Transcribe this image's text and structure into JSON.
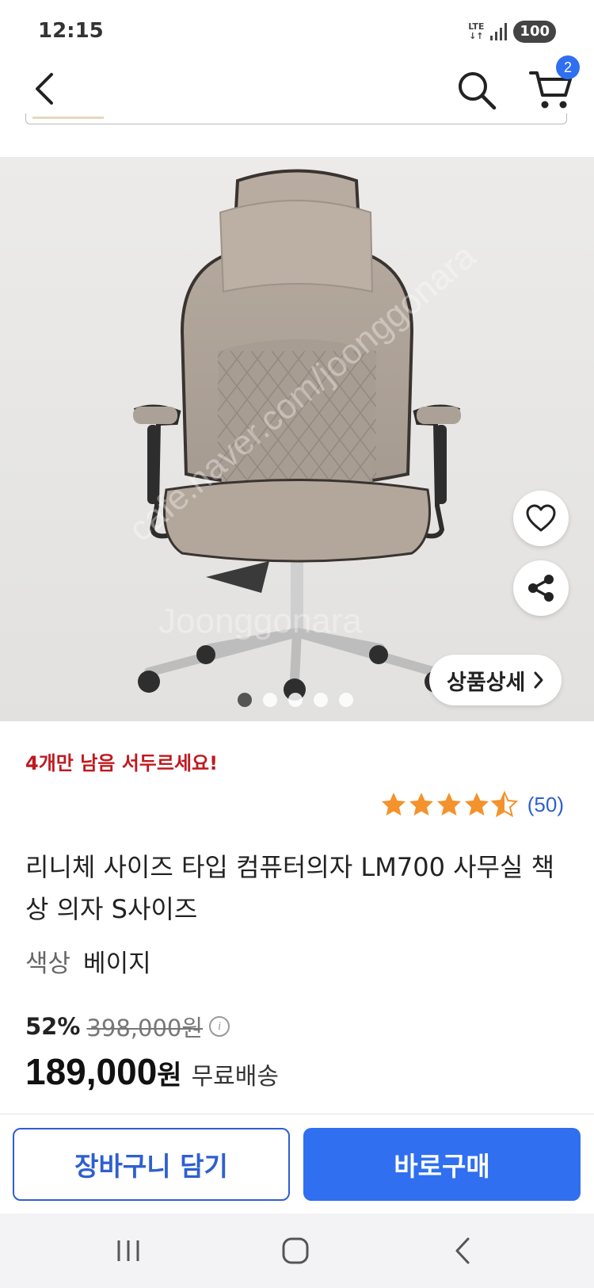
{
  "status_bar": {
    "time": "12:15",
    "network": "LTE",
    "battery": "100"
  },
  "header": {
    "cart_count": "2"
  },
  "image_carousel": {
    "detail_label": "상품상세",
    "total_slides": 5,
    "active_slide": 1
  },
  "product": {
    "stock_alert": "4개만 남음 서두르세요!",
    "rating_value": 4.5,
    "rating_count": "(50)",
    "title": "리니체 사이즈 타입 컴퓨터의자 LM700 사무실 책상 의자 S사이즈",
    "option_label": "색상",
    "option_value": "베이지",
    "discount": "52%",
    "original_price": "398,000원",
    "price": "189,000",
    "price_unit": "원",
    "shipping": "무료배송"
  },
  "actions": {
    "add_to_cart": "장바구니 담기",
    "buy_now": "바로구매"
  },
  "colors": {
    "accent": "#2f6ff0",
    "alert": "#c0191e",
    "star": "#f4922b"
  }
}
